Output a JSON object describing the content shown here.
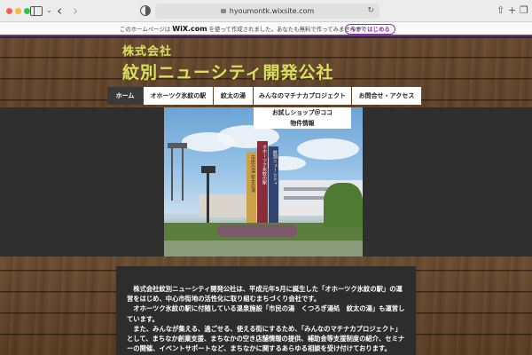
{
  "browser": {
    "url": "hyoumontk.wixsite.com"
  },
  "wix_banner": {
    "text_before": "このホームページは",
    "brand": "WiX.com",
    "text_after": "を使って作成されました。あなたも無料で作ってみませんか？",
    "cta": "今すぐはじめる"
  },
  "header": {
    "company_type": "株式会社",
    "company_name": "紋別ニューシティ開発公社"
  },
  "nav": {
    "items": [
      {
        "label": "ホーム"
      },
      {
        "label": "オホーツク氷紋の駅"
      },
      {
        "label": "紋太の湯"
      },
      {
        "label": "みんなのマチナカプロジェクト"
      },
      {
        "label": "お問合せ・アクセス"
      }
    ]
  },
  "dropdown": {
    "items": [
      {
        "label": "お試しショップ＠ココ"
      },
      {
        "label": "物件情報"
      }
    ]
  },
  "content": {
    "paragraphs": [
      "　株式会社紋別ニューシティ開発公社は、平成元年5月に誕生した「オホーツク氷紋の駅」の運営をはじめ、中心市街地の活性化に取り組むまちづくり会社です。",
      "　オホーツク氷紋の駅に付随している温泉施設「市民の湯　くつろぎ湯処　紋太の湯」も運営しています。",
      "　また、みんなが集える、過ごせる、使える街にするため、「みんなのマチナカプロジェクト」として、まちなか創業支援、まちなかの空き店舗情報の提供、補助金等支援制度の紹介、セミナーの開催、イベントサポートなど、まちなかに関するあらゆる相談を受け付けております。"
    ]
  },
  "photo": {
    "banners": [
      "オホーツク氷紋の駅",
      "市民の湯 紋太の湯",
      "紋別ニューシティ"
    ]
  },
  "colors": {
    "accent": "#d6e25a",
    "wix_purple": "#8d3ca4",
    "nav_active": "#3a3a3a",
    "dark_band": "#2f2f2f"
  }
}
